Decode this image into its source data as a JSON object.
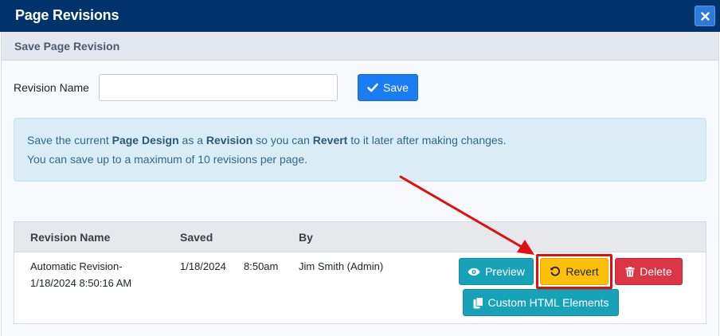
{
  "dialog": {
    "title": "Page Revisions",
    "close_icon": "close-icon"
  },
  "save_section": {
    "header": "Save Page Revision",
    "revision_name_label": "Revision Name",
    "revision_name_value": "",
    "save_label": "Save",
    "save_icon": "check-icon"
  },
  "info": {
    "line1_pre": "Save the current ",
    "line1_b1": "Page Design",
    "line1_mid1": " as a ",
    "line1_b2": "Revision",
    "line1_mid2": " so you can ",
    "line1_b3": "Revert",
    "line1_post": " to it later after making changes.",
    "line2": "You can save up to a maximum of 10 revisions per page."
  },
  "table": {
    "headers": [
      "Revision Name",
      "Saved",
      "By"
    ],
    "rows": [
      {
        "name_line1": "Automatic Revision-",
        "name_line2": "1/18/2024 8:50:16 AM",
        "saved_date": "1/18/2024",
        "saved_time": "8:50am",
        "by": "Jim Smith (Admin)",
        "actions": {
          "preview": "Preview",
          "revert": "Revert",
          "delete": "Delete",
          "custom_html": "Custom HTML Elements"
        }
      }
    ]
  },
  "colors": {
    "title_bar": "#00336b",
    "save_button": "#1a7cf5",
    "preview_button": "#17a2b8",
    "revert_button": "#ffc107",
    "delete_button": "#dc3545",
    "highlight": "#e01010"
  }
}
